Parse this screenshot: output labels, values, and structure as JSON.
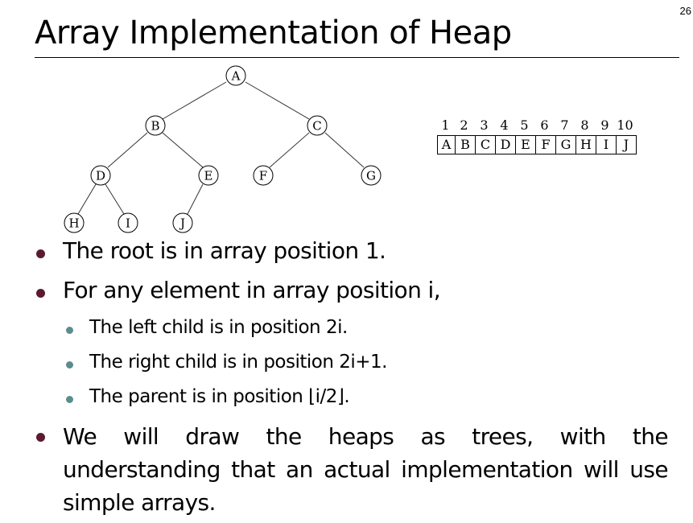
{
  "slide_number": "26",
  "title": "Array Implementation of Heap",
  "tree": {
    "nodes": [
      "A",
      "B",
      "C",
      "D",
      "E",
      "F",
      "G",
      "H",
      "I",
      "J"
    ]
  },
  "array": {
    "indices": [
      "1",
      "2",
      "3",
      "4",
      "5",
      "6",
      "7",
      "8",
      "9",
      "10"
    ],
    "cells": [
      "A",
      "B",
      "C",
      "D",
      "E",
      "F",
      "G",
      "H",
      "I",
      "J"
    ]
  },
  "bullets": {
    "root": "The root is in array position 1.",
    "any": "For any element in array position i,",
    "left": "The left child is in position 2i.",
    "right": "The right child is in position 2i+1.",
    "parent": "The parent is in position ⌊i/2⌋.",
    "draw": "We will draw the heaps as trees, with the understanding that an actual implementation will use simple arrays."
  }
}
